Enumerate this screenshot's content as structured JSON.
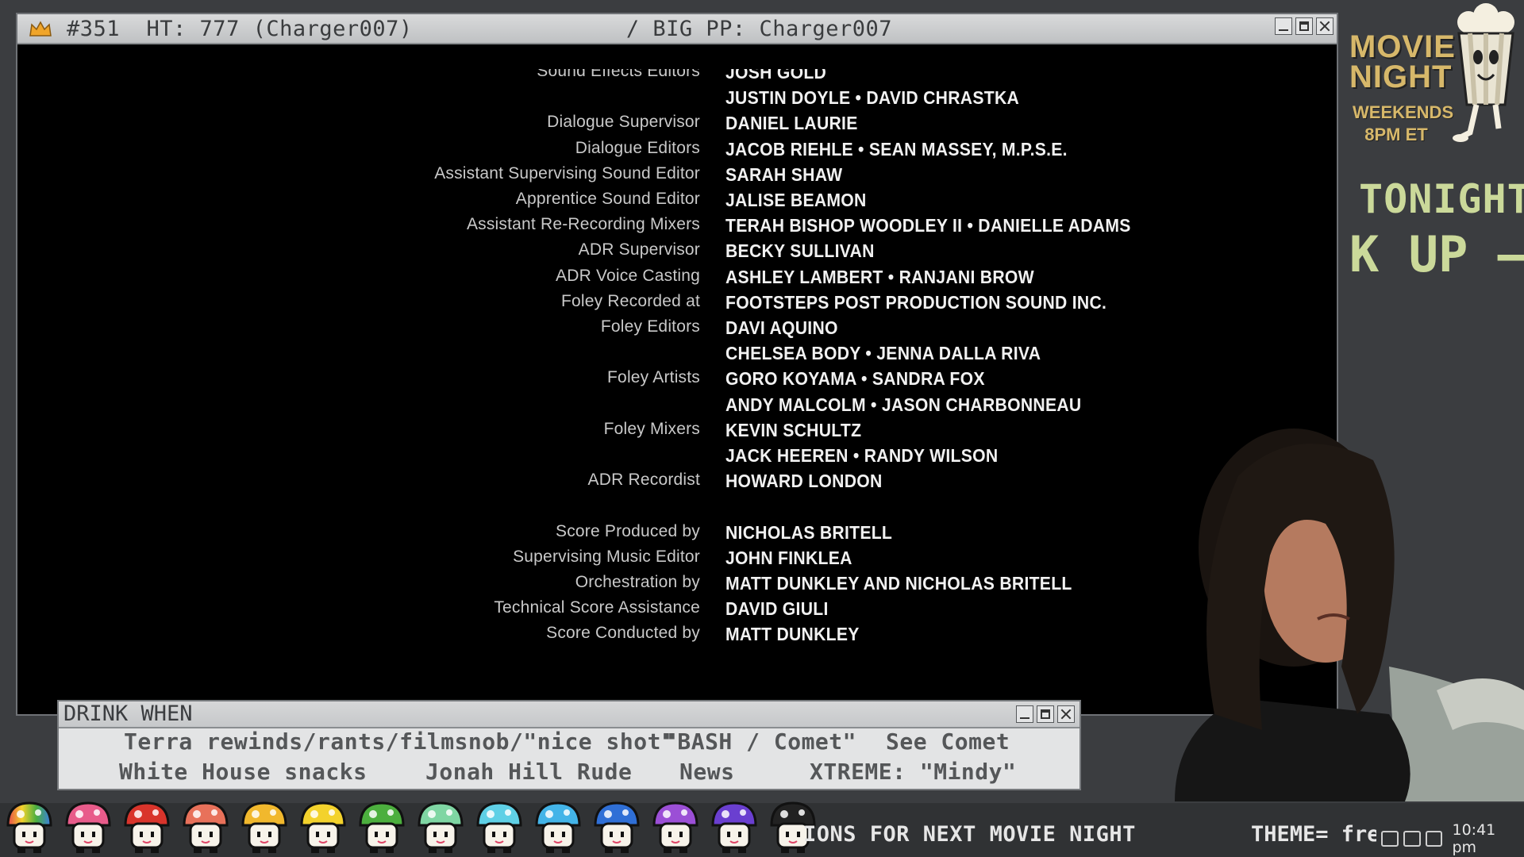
{
  "window": {
    "title_left": "#351  HT: 777 (Charger007)",
    "title_right": "/ BIG PP: Charger007"
  },
  "credits": [
    {
      "role": "Sound Effects Editors",
      "names": "JOSH GOLD",
      "cut": true
    },
    {
      "role": "",
      "names": "JUSTIN DOYLE • DAVID CHRASTKA"
    },
    {
      "role": "Dialogue Supervisor",
      "names": "DANIEL LAURIE"
    },
    {
      "role": "Dialogue Editors",
      "names": "JACOB RIEHLE • SEAN MASSEY, M.P.S.E."
    },
    {
      "role": "Assistant Supervising Sound Editor",
      "names": "SARAH SHAW"
    },
    {
      "role": "Apprentice Sound Editor",
      "names": "JALISE BEAMON"
    },
    {
      "role": "Assistant Re-Recording Mixers",
      "names": "TERAH BISHOP WOODLEY II • DANIELLE ADAMS"
    },
    {
      "role": "ADR Supervisor",
      "names": "BECKY SULLIVAN"
    },
    {
      "role": "ADR Voice Casting",
      "names": "ASHLEY LAMBERT • RANJANI BROW"
    },
    {
      "role": "Foley Recorded at",
      "names": "FOOTSTEPS POST PRODUCTION SOUND INC."
    },
    {
      "role": "Foley Editors",
      "names": "DAVI AQUINO"
    },
    {
      "role": "",
      "names": "CHELSEA BODY • JENNA DALLA RIVA"
    },
    {
      "role": "Foley Artists",
      "names": "GORO KOYAMA • SANDRA FOX"
    },
    {
      "role": "",
      "names": "ANDY MALCOLM • JASON CHARBONNEAU"
    },
    {
      "role": "Foley Mixers",
      "names": "KEVIN SCHULTZ"
    },
    {
      "role": "",
      "names": "JACK HEEREN • RANDY WILSON"
    },
    {
      "role": "ADR Recordist",
      "names": "HOWARD LONDON"
    },
    {
      "role": "",
      "names": ""
    },
    {
      "role": "Score Produced by",
      "names": "NICHOLAS BRITELL"
    },
    {
      "role": "Supervising Music Editor",
      "names": "JOHN FINKLEA"
    },
    {
      "role": "Orchestration by",
      "names": "MATT DUNKLEY AND NICHOLAS BRITELL"
    },
    {
      "role": "Technical Score Assistance",
      "names": "DAVID GIULI"
    },
    {
      "role": "Score Conducted by",
      "names": "MATT DUNKLEY"
    }
  ],
  "drink_panel": {
    "title": "DRINK WHEN",
    "items": [
      "Terra rewinds/rants/filmsnob/\"nice shot\"",
      "\"BASH / Comet\"",
      "See Comet",
      "White House snacks",
      "Jonah Hill Rude",
      "News",
      "XTREME: \"Mindy\""
    ]
  },
  "sidebar": {
    "logo_line1": "MOVIE",
    "logo_line2": "NIGHT",
    "logo_sub1": "WEEKENDS",
    "logo_sub2": "8PM ET",
    "tonight": "TONIGHT:",
    "marquee": "K UP –"
  },
  "bottom": {
    "ticker": "IONS FOR NEXT MOVIE NIGHT",
    "theme": "THEME= fre",
    "clock": "10:41 pm"
  },
  "colors": {
    "accent_gold": "#d7b86a",
    "sidebar_text": "#cbd99a",
    "sprite_colors": [
      "rainbow",
      "#e85b8a",
      "#d9342b",
      "#e8715a",
      "#f1b82d",
      "#f3d22c",
      "#4caf3e",
      "#7fd6a3",
      "#5fd0e6",
      "#43b4e8",
      "#2f6fd6",
      "#9b4fd6",
      "#6a3fd0",
      "#222222"
    ]
  }
}
